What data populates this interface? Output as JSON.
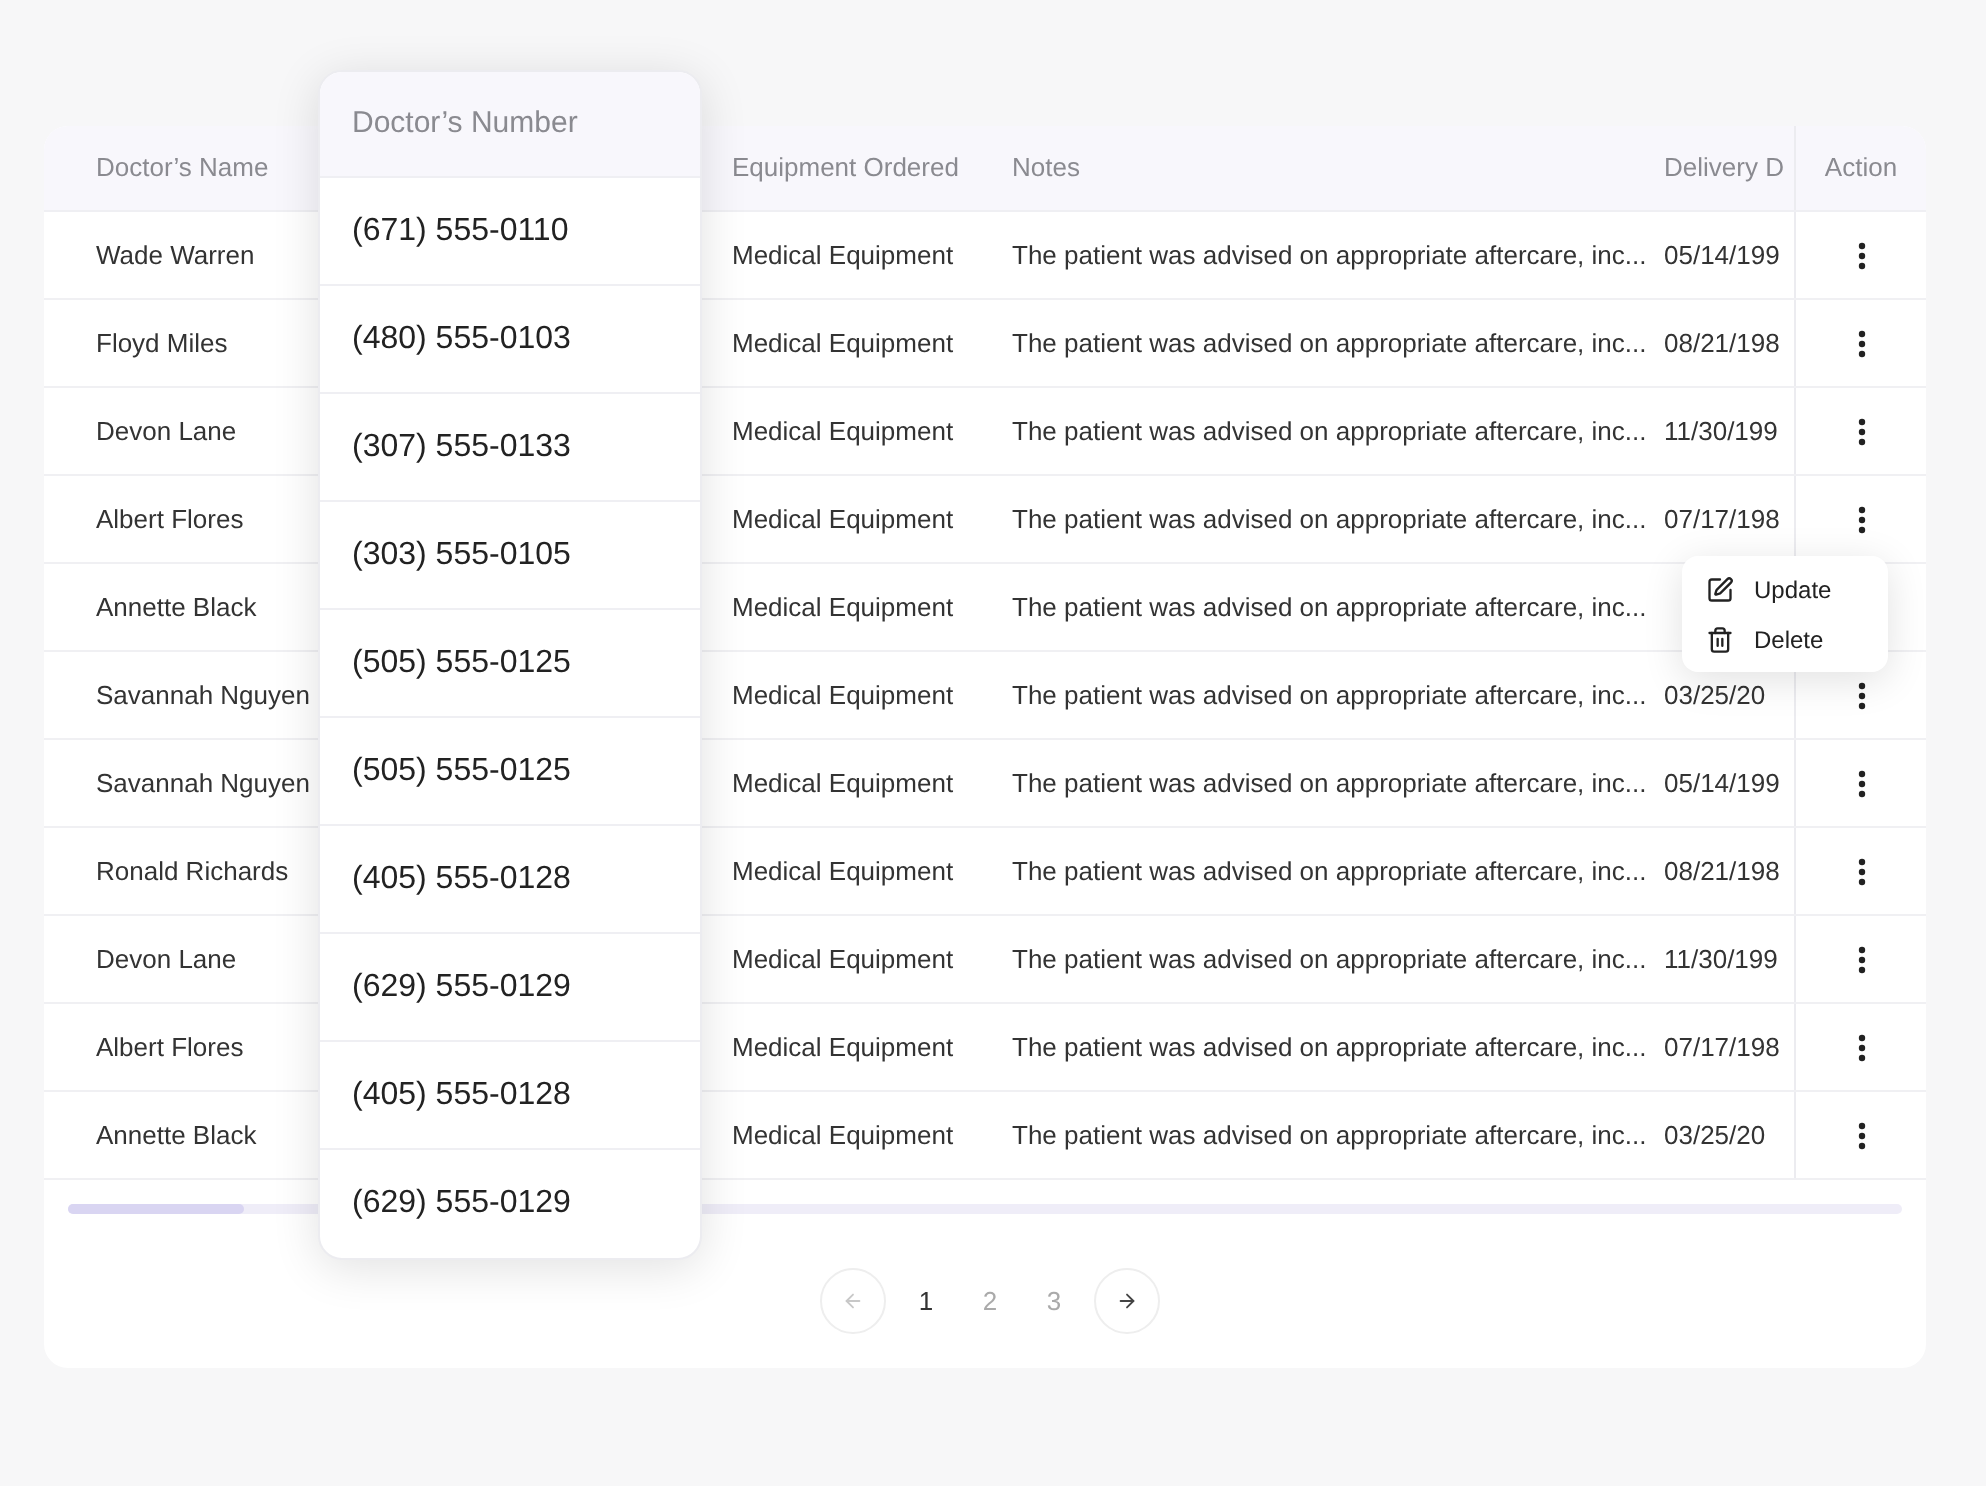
{
  "table": {
    "columns": [
      {
        "kind": "name",
        "label": "Doctor’s Name"
      },
      {
        "kind": "hidden"
      },
      {
        "kind": "equipment",
        "label": "Equipment Ordered"
      },
      {
        "kind": "notes",
        "label": "Notes"
      },
      {
        "kind": "date",
        "label": "Delivery D"
      },
      {
        "kind": "action",
        "label": "Action"
      }
    ],
    "rows": [
      {
        "doctor_name": "Wade Warren",
        "equipment": "Medical Equipment",
        "notes": "The patient was advised on appropriate aftercare, inc...",
        "delivery_date": "05/14/199",
        "menu_open": false
      },
      {
        "doctor_name": "Floyd Miles",
        "equipment": "Medical Equipment",
        "notes": "The patient was advised on appropriate aftercare, inc...",
        "delivery_date": "08/21/198",
        "menu_open": false
      },
      {
        "doctor_name": "Devon Lane",
        "equipment": "Medical Equipment",
        "notes": "The patient was advised on appropriate aftercare, inc...",
        "delivery_date": "11/30/199",
        "menu_open": false
      },
      {
        "doctor_name": "Albert Flores",
        "equipment": "Medical Equipment",
        "notes": "The patient was advised on appropriate aftercare, inc...",
        "delivery_date": "07/17/198",
        "menu_open": true
      },
      {
        "doctor_name": "Annette Black",
        "equipment": "Medical Equipment",
        "notes": "The patient was advised on appropriate aftercare, inc...",
        "menu_open": false
      },
      {
        "doctor_name": "Savannah Nguyen",
        "equipment": "Medical Equipment",
        "notes": "The patient was advised on appropriate aftercare, inc...",
        "delivery_date": "03/25/20",
        "menu_open": false
      },
      {
        "doctor_name": "Savannah Nguyen",
        "equipment": "Medical Equipment",
        "notes": "The patient was advised on appropriate aftercare, inc...",
        "delivery_date": "05/14/199",
        "menu_open": false
      },
      {
        "doctor_name": "Ronald Richards",
        "equipment": "Medical Equipment",
        "notes": "The patient was advised on appropriate aftercare, inc...",
        "delivery_date": "08/21/198",
        "menu_open": false
      },
      {
        "doctor_name": "Devon Lane",
        "equipment": "Medical Equipment",
        "notes": "The patient was advised on appropriate aftercare, inc...",
        "delivery_date": "11/30/199",
        "menu_open": false
      },
      {
        "doctor_name": "Albert Flores",
        "equipment": "Medical Equipment",
        "notes": "The patient was advised on appropriate aftercare, inc...",
        "delivery_date": "07/17/198",
        "menu_open": false
      },
      {
        "doctor_name": "Annette Black",
        "equipment": "Medical Equipment",
        "notes": "The patient was advised on appropriate aftercare, inc...",
        "delivery_date": "03/25/20",
        "menu_open": false
      }
    ]
  },
  "action_menu": {
    "items": [
      {
        "kind": "edit",
        "label": "Update"
      },
      {
        "kind": "delete",
        "label": "Delete"
      }
    ]
  },
  "number_panel": {
    "title": "Doctor’s Number",
    "numbers": [
      "(671) 555-0110",
      "(480) 555-0103",
      "(307) 555-0133",
      "(303) 555-0105",
      "(505) 555-0125",
      "(505) 555-0125",
      "(405) 555-0128",
      "(629) 555-0129",
      "(405) 555-0128",
      "(629) 555-0129"
    ]
  },
  "pagination": {
    "previous_disabled": true,
    "next_disabled": false,
    "pages": [
      {
        "label": "1",
        "selected": true
      },
      {
        "label": "2",
        "selected": false
      },
      {
        "label": "3",
        "selected": false
      }
    ]
  }
}
